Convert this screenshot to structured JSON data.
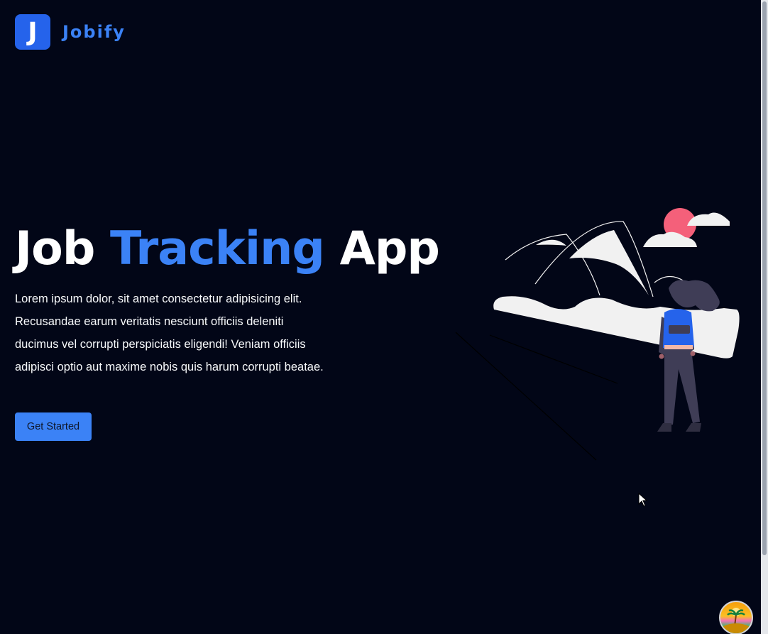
{
  "brand": {
    "logo_letter": "J",
    "name": "Jobify"
  },
  "hero": {
    "title_part1": "Job ",
    "title_accent": "Tracking",
    "title_part2": " App",
    "description": "Lorem ipsum dolor, sit amet consectetur adipisicing elit. Recusandae earum veritatis nesciunt officiis deleniti ducimus vel corrupti perspiciatis eligendi! Veniam officiis adipisci optio aut maxime nobis quis harum corrupti beatae.",
    "cta_label": "Get Started"
  },
  "illustration": {
    "icon": "woman-with-backpack-viewing-mountains"
  },
  "colors": {
    "background": "#020617",
    "accent": "#3b82f6",
    "logo_bg": "#2563eb",
    "sun": "#f4607a",
    "snow": "#f1f1f1"
  }
}
